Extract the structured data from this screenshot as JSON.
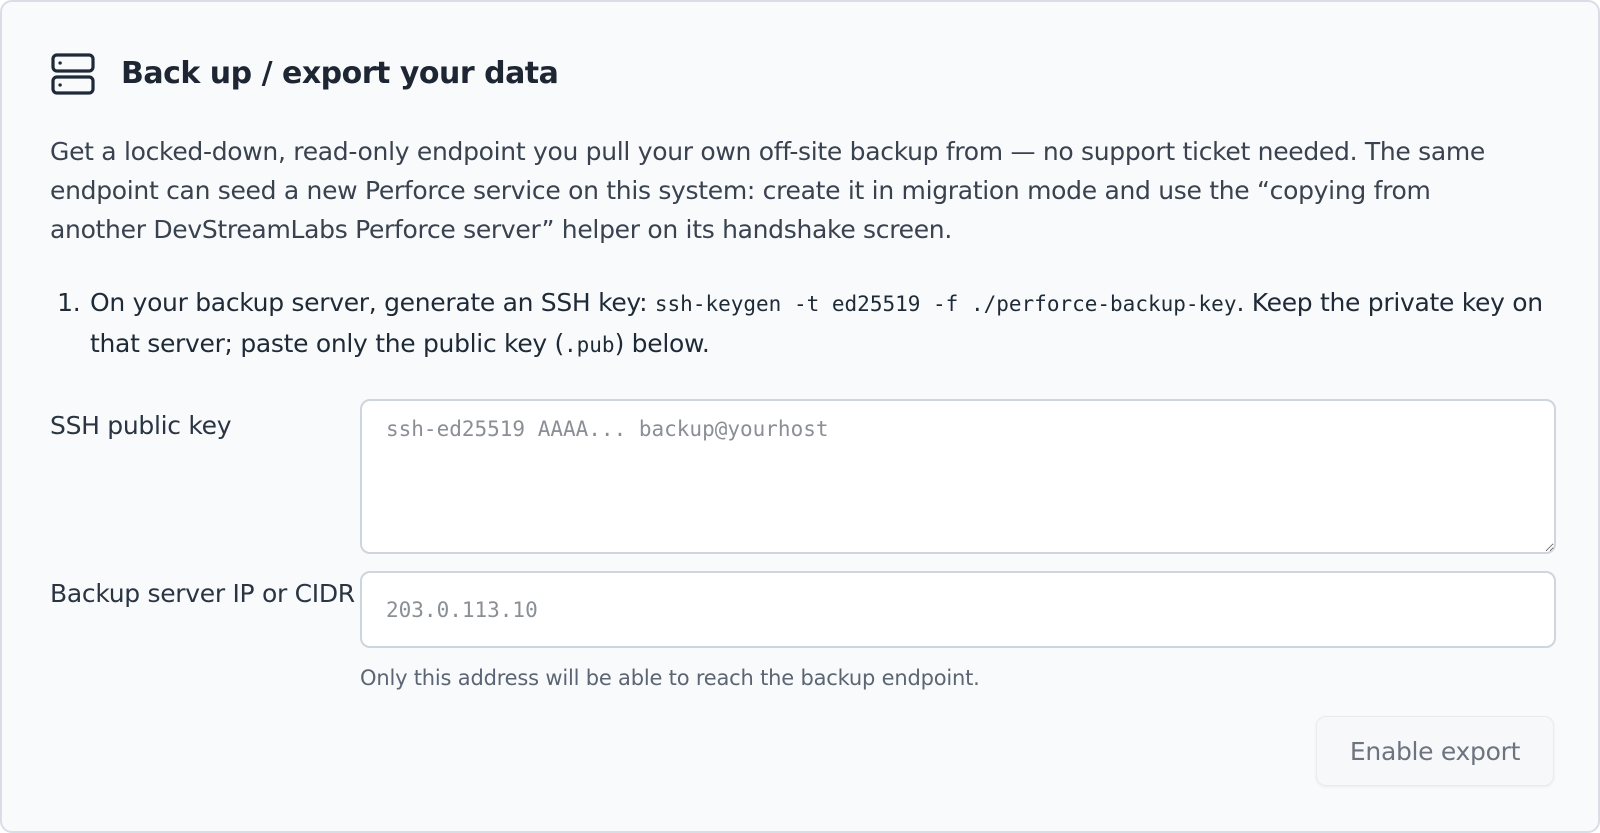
{
  "card": {
    "icon": "server-stack-icon",
    "title": "Back up / export your data",
    "intro": "Get a locked-down, read-only endpoint you pull your own off-site backup from — no support ticket needed. The same endpoint can seed a new Perforce service on this system: create it in migration mode and use the “copying from another DevStreamLabs Perforce server” helper on its handshake screen."
  },
  "steps": [
    {
      "number": "1.",
      "text_before": "On your backup server, generate an SSH key: ",
      "command": "ssh-keygen -t ed25519 -f ./perforce-backup-key",
      "text_middle": ". Keep the private key on that server; paste only the public key (",
      "file_ext": ".pub",
      "text_after": ") below."
    }
  ],
  "form": {
    "ssh_key": {
      "label": "SSH public key",
      "value": "",
      "placeholder": "ssh-ed25519 AAAA... backup@yourhost"
    },
    "backup_ip": {
      "label": "Backup server IP or CIDR",
      "value": "",
      "placeholder": "203.0.113.10",
      "help": "Only this address will be able to reach the backup endpoint."
    },
    "submit": {
      "label": "Enable export",
      "state": "disabled"
    }
  },
  "colors": {
    "card_background": "#f8fafc",
    "card_border": "#d9dee6",
    "title_text": "#1e2533",
    "body_text": "#39424e",
    "muted_text": "#5b6573",
    "placeholder_text": "#8a8f96",
    "disabled_button_text": "#6d7480"
  }
}
